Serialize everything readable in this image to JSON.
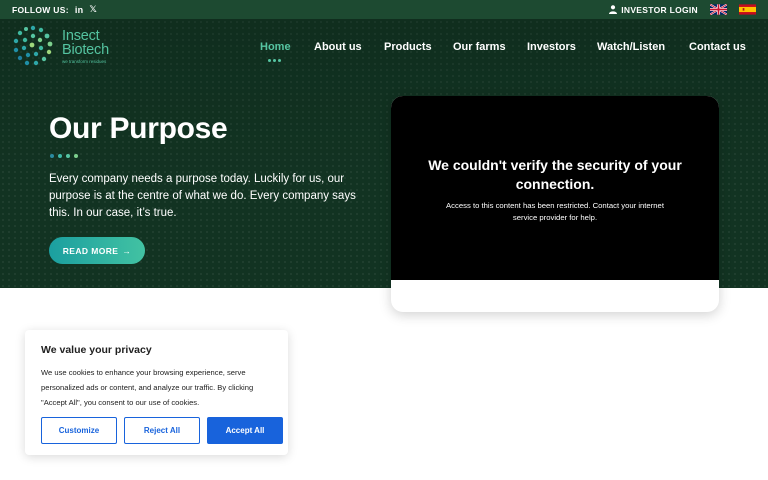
{
  "topbar": {
    "follow_label": "FOLLOW US:",
    "social": [
      {
        "name": "linkedin-icon",
        "text": "in"
      },
      {
        "name": "x-icon",
        "text": "𝕏"
      }
    ],
    "investor_login": "INVESTOR LOGIN",
    "languages": [
      "English",
      "Spanish"
    ]
  },
  "logo": {
    "name_line1": "Insect",
    "name_line2": "Biotech",
    "tagline": "we transform residues"
  },
  "nav": {
    "items": [
      {
        "label": "Home",
        "active": true
      },
      {
        "label": "About us",
        "active": false
      },
      {
        "label": "Products",
        "active": false
      },
      {
        "label": "Our farms",
        "active": false
      },
      {
        "label": "Investors",
        "active": false
      },
      {
        "label": "Watch/Listen",
        "active": false
      },
      {
        "label": "Contact us",
        "active": false
      }
    ]
  },
  "hero": {
    "title": "Our Purpose",
    "body": "Every company needs a purpose today. Luckily for us, our purpose is at the centre of what we do. Every company says this. In our case, it’s true.",
    "button": "READ MORE",
    "button_arrow": "→"
  },
  "video": {
    "error_title": "We couldn't verify the security of your connection.",
    "error_message": "Access to this content has been restricted. Contact your internet service provider for help."
  },
  "cookie": {
    "title": "We value your privacy",
    "text": "We use cookies to enhance your browsing experience, serve personalized ads or content, and analyze our traffic. By clicking \"Accept All\", you consent to our use of cookies.",
    "customize": "Customize",
    "reject": "Reject All",
    "accept": "Accept All"
  },
  "colors": {
    "topbar": "#1d4a31",
    "hero_bg": "#123322",
    "accent": "#56c5a2",
    "cookie_button": "#1863dc"
  }
}
